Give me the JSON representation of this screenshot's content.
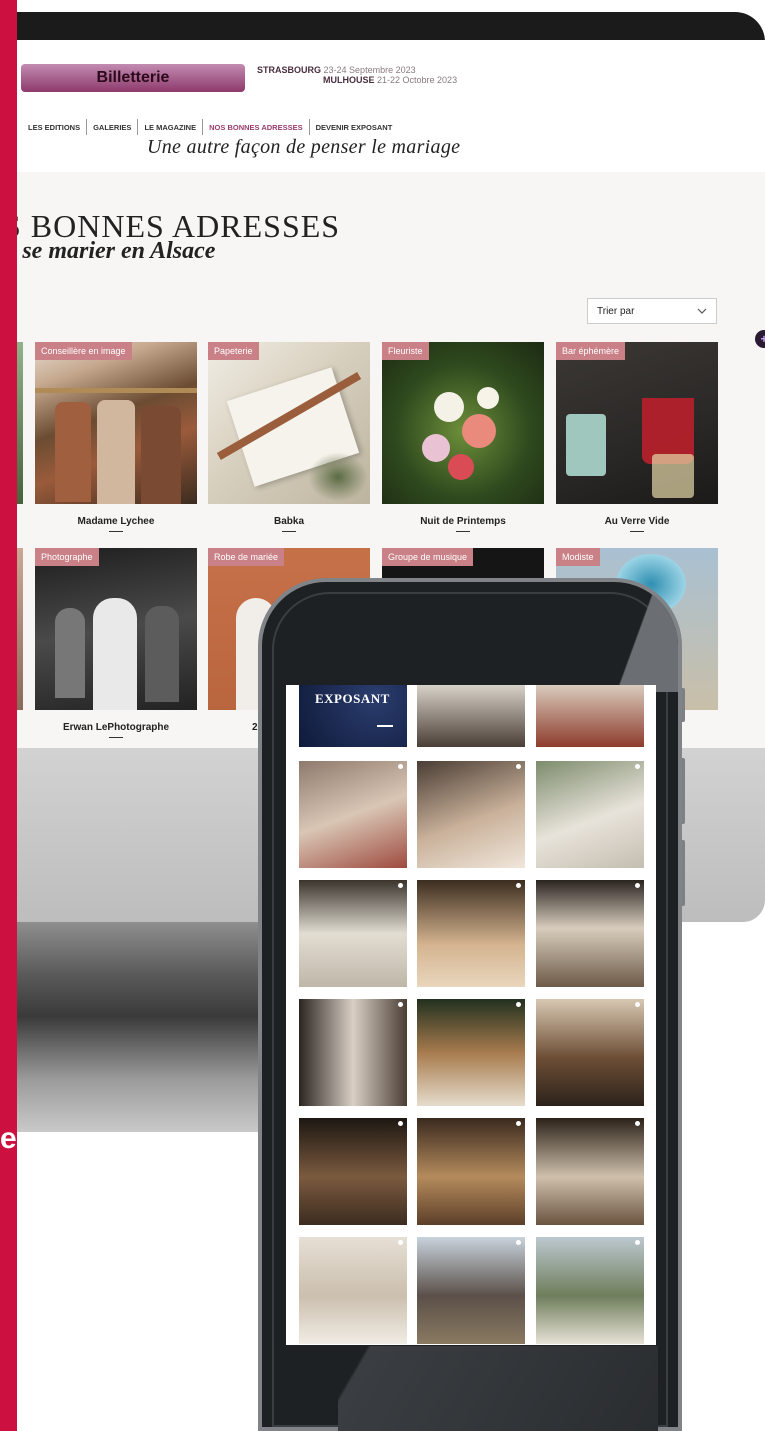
{
  "site": {
    "ticket_button": "Billetterie",
    "events": [
      {
        "city": "STRASBOURG",
        "dates": "23-24 Septembre 2023"
      },
      {
        "city": "MULHOUSE",
        "dates": "21-22 Octobre 2023"
      }
    ],
    "nav": [
      "LES EDITIONS",
      "GALERIES",
      "LE MAGAZINE",
      "NOS BONNES ADRESSES",
      "DEVENIR EXPOSANT"
    ],
    "tagline": "Une autre façon de penser le mariage",
    "title": "S BONNES ADRESSES",
    "subtitle": "r se marier en Alsace",
    "sort_label": "Trier par",
    "sort_icon": "chevron-down-icon",
    "float_icon": "plus-icon"
  },
  "cards": [
    {
      "category": "Conseillère en image",
      "name": "Madame Lychee",
      "palette": "#6b4c32"
    },
    {
      "category": "Papeterie",
      "name": "Babka",
      "palette": "#d8d0bf"
    },
    {
      "category": "Fleuriste",
      "name": "Nuit de Printemps",
      "palette": "#2f4a1e"
    },
    {
      "category": "Bar éphémère",
      "name": "Au Verre Vide",
      "palette": "#2a2826"
    },
    {
      "category": "Photographe",
      "name": "Erwan LePhotographe",
      "palette": "#3b3b3b"
    },
    {
      "category": "Robe de mariée",
      "name": "26",
      "palette": "#b9653d"
    },
    {
      "category": "Groupe de musique",
      "name": "",
      "palette": "#151515"
    },
    {
      "category": "Modiste",
      "name": "",
      "palette": "#9ab4c8"
    }
  ],
  "phone": {
    "exposant_label": "EXPOSANT"
  },
  "colors": {
    "accent_red": "#cc1040",
    "category_tag": "#c98086",
    "nav_active": "#9b3d6c"
  }
}
